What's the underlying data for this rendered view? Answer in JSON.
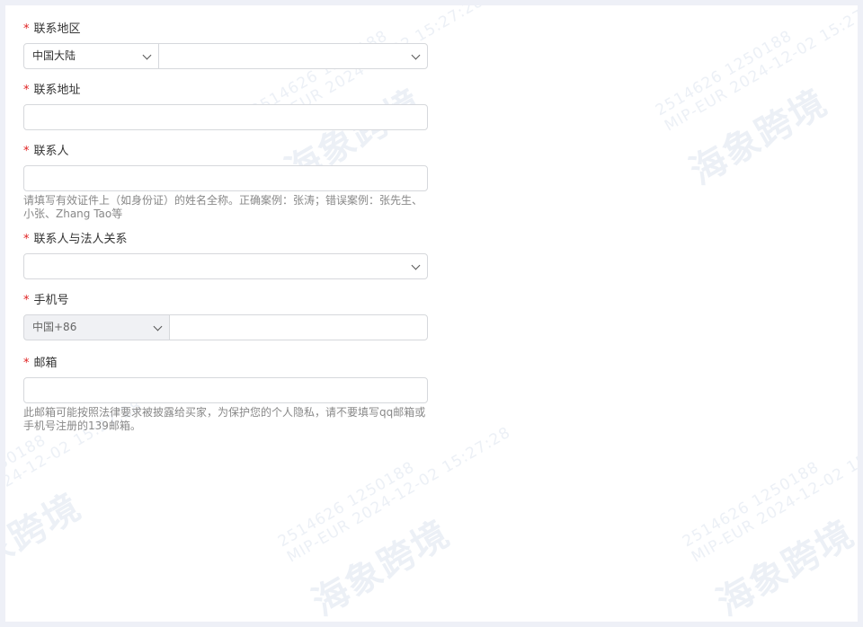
{
  "form": {
    "region": {
      "label": "联系地区",
      "required_mark": "*",
      "country_value": "中国大陆",
      "subregion_value": ""
    },
    "address": {
      "label": "联系地址",
      "required_mark": "*",
      "value": ""
    },
    "contact": {
      "label": "联系人",
      "required_mark": "*",
      "value": "",
      "hint": "请填写有效证件上（如身份证）的姓名全称。正确案例：张涛；错误案例：张先生、小张、Zhang Tao等"
    },
    "relation": {
      "label": "联系人与法人关系",
      "required_mark": "*",
      "value": ""
    },
    "phone": {
      "label": "手机号",
      "required_mark": "*",
      "country_code": "中国+86",
      "value": ""
    },
    "email": {
      "label": "邮箱",
      "required_mark": "*",
      "value": "",
      "hint": "此邮箱可能按照法律要求被披露给买家，为保护您的个人隐私，请不要填写qq邮箱或手机号注册的139邮箱。"
    }
  },
  "watermark": {
    "id_line": "2514626 1250188",
    "meta_line": "MIP-EUR 2024-12-02 15:27:28",
    "brand": "海象跨境"
  },
  "colors": {
    "required": "#e02020",
    "border": "#d6d8dc",
    "hint_text": "#888888",
    "background": "#eef0f7"
  }
}
